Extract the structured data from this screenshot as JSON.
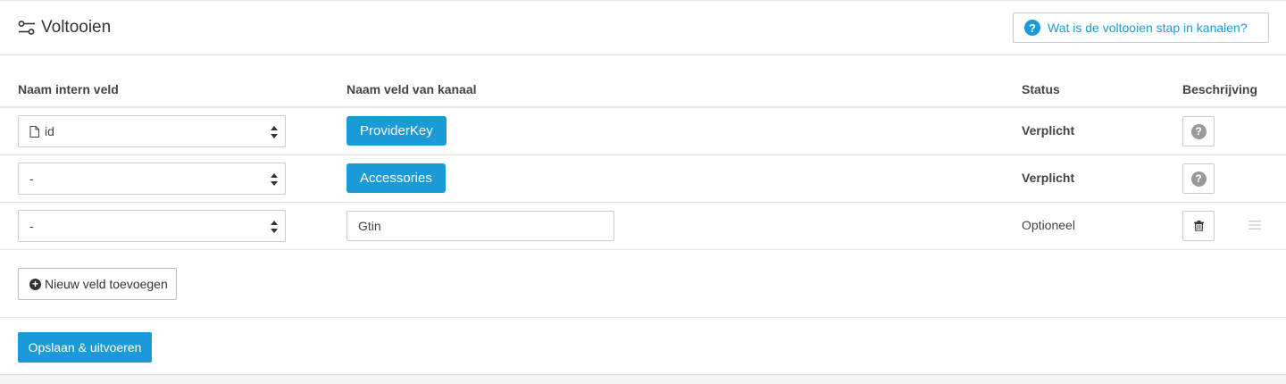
{
  "header": {
    "title": "Voltooien",
    "help_label": "Wat is de voltooien stap in kanalen?"
  },
  "table": {
    "columns": [
      "Naam intern veld",
      "Naam veld van kanaal",
      "Status",
      "Beschrijving"
    ],
    "rows": [
      {
        "internal_field": "id",
        "channel_field": "ProviderKey",
        "status": "Verplicht",
        "description_action": "help"
      },
      {
        "internal_field": "-",
        "channel_field": "Accessories",
        "status": "Verplicht",
        "description_action": "help"
      },
      {
        "internal_field": "-",
        "channel_field": "Gtin",
        "status": "Optioneel",
        "description_action": "delete"
      }
    ]
  },
  "actions": {
    "add_field_label": "Nieuw veld toevoegen",
    "save_label": "Opslaan & uitvoeren"
  },
  "icons": {
    "title": "sliders-icon",
    "help": "question-circle-icon",
    "doc": "file-icon",
    "select_arrows": "sort-arrows-icon",
    "description_help": "question-icon",
    "delete": "trash-icon",
    "drag": "drag-handle-icon",
    "add": "plus-circle-icon"
  },
  "colors": {
    "accent": "#1a9ad6",
    "border": "#cccccc",
    "text": "#333333"
  }
}
